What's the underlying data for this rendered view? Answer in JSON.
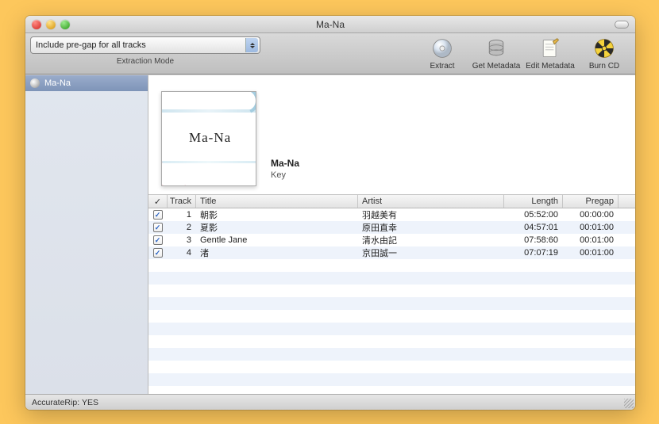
{
  "window": {
    "title": "Ma-Na"
  },
  "toolbar": {
    "mode_value": "Include pre-gap for all tracks",
    "mode_label": "Extraction Mode",
    "buttons": {
      "extract": "Extract",
      "get_metadata": "Get Metadata",
      "edit_metadata": "Edit Metadata",
      "burn_cd": "Burn CD"
    }
  },
  "sidebar": {
    "items": [
      {
        "label": "Ma-Na"
      }
    ]
  },
  "album": {
    "title": "Ma-Na",
    "artist": "Key",
    "cover_signature": "Ma-Na"
  },
  "table": {
    "headers": {
      "check": "✓",
      "track": "Track",
      "title": "Title",
      "artist": "Artist",
      "length": "Length",
      "pregap": "Pregap"
    },
    "rows": [
      {
        "checked": true,
        "track": 1,
        "title": "朝影",
        "artist": "羽越美有",
        "length": "05:52:00",
        "pregap": "00:00:00"
      },
      {
        "checked": true,
        "track": 2,
        "title": "夏影",
        "artist": "原田直幸",
        "length": "04:57:01",
        "pregap": "00:01:00"
      },
      {
        "checked": true,
        "track": 3,
        "title": "Gentle Jane",
        "artist": "清水由記",
        "length": "07:58:60",
        "pregap": "00:01:00"
      },
      {
        "checked": true,
        "track": 4,
        "title": "渚",
        "artist": "京田誠一",
        "length": "07:07:19",
        "pregap": "00:01:00"
      }
    ],
    "blank_rows": 13
  },
  "status": {
    "accuraterip_label": "AccurateRip:",
    "accuraterip_value": "YES"
  }
}
